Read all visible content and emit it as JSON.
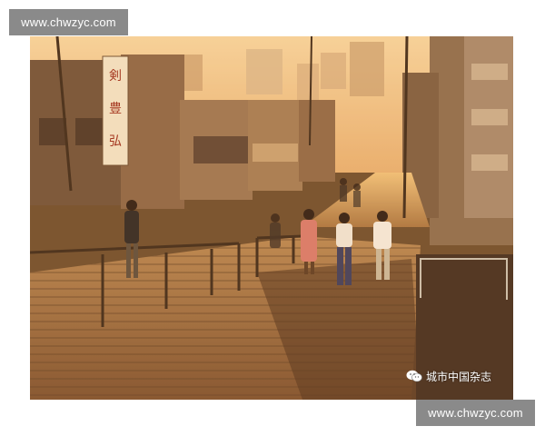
{
  "watermark_top": "www.chwzyc.com",
  "watermark_bottom": "www.chwzyc.com",
  "credit": {
    "icon": "wechat-icon",
    "text": "城市中国杂志"
  },
  "photo": {
    "sign_vertical_text": "剣 豊 弘",
    "colors": {
      "sky": "#f2c98a",
      "stairs": "#8a5a33",
      "shadow": "#4a2e1a",
      "buildings": "#7a5a3e"
    }
  }
}
